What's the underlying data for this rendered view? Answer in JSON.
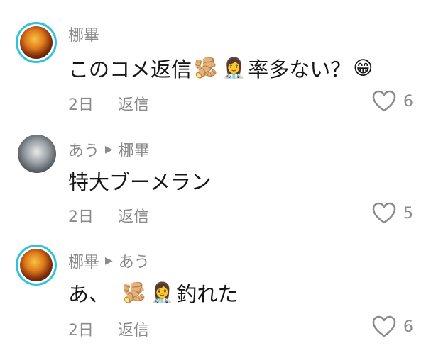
{
  "comments": [
    {
      "author": "梛畢",
      "reply_to": "",
      "text_before": "このコメ返信",
      "emojis": [
        "🫚",
        "👩‍⚕️"
      ],
      "text_after": "率多ない？",
      "trailing_emoji": "😁",
      "time": "2日",
      "reply_label": "返信",
      "likes": "6"
    },
    {
      "author": "あう",
      "reply_to": "梛畢",
      "text": "特大ブーメラン",
      "time": "2日",
      "reply_label": "返信",
      "likes": "5"
    },
    {
      "author": "梛畢",
      "reply_to": "あう",
      "text_before": "あ、",
      "emojis": [
        "🫚",
        "👩‍⚕️"
      ],
      "text_after": "釣れた",
      "time": "2日",
      "reply_label": "返信",
      "likes": "6"
    }
  ]
}
